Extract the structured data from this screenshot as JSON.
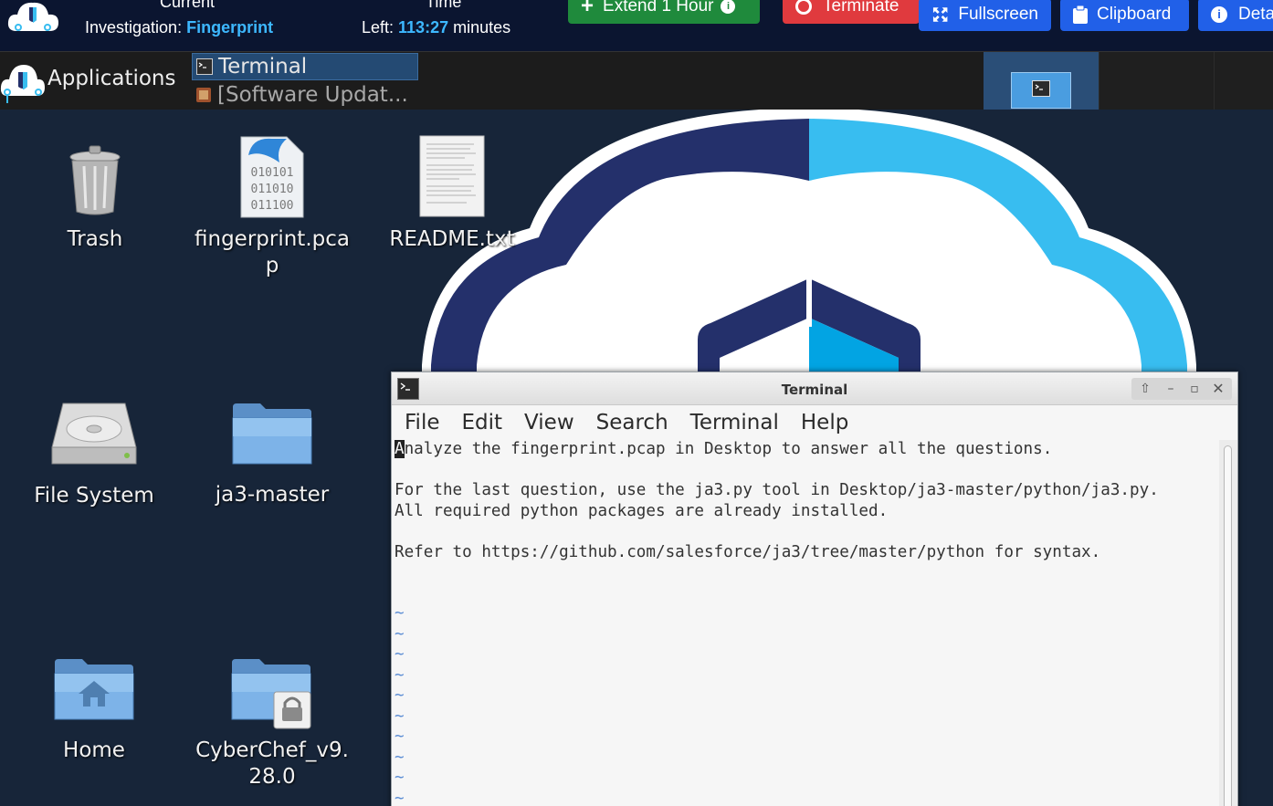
{
  "topbar": {
    "current_label": "Current",
    "investigation_label": "Investigation: ",
    "investigation_name": "Fingerprint",
    "time_label": "Time",
    "left_label": "Left: ",
    "time_left": "113:27",
    "minutes_label": " minutes",
    "extend_label": "Extend 1 Hour",
    "terminate_label": "Terminate",
    "fullscreen_label": "Fullscreen",
    "clipboard_label": "Clipboard",
    "details_label": "Deta"
  },
  "panel": {
    "applications_label": "Applications",
    "tasks": [
      {
        "label": "Terminal"
      },
      {
        "label": "[Software Updat..."
      }
    ]
  },
  "desktop": {
    "icons": [
      {
        "label": "Trash"
      },
      {
        "label": "fingerprint.pcap"
      },
      {
        "label": "README.txt"
      },
      {
        "label": "File System"
      },
      {
        "label": "ja3-master"
      },
      {
        "label": "Home"
      },
      {
        "label": "CyberChef_v9.28.0"
      }
    ],
    "pcap_bits": [
      "010101",
      "011010",
      "011100"
    ]
  },
  "terminal": {
    "title": "Terminal",
    "menu": [
      "File",
      "Edit",
      "View",
      "Search",
      "Terminal",
      "Help"
    ],
    "cursor_char": "A",
    "lines": [
      "nalyze the fingerprint.pcap in Desktop to answer all the questions.",
      "For the last question, use the ja3.py tool in Desktop/ja3-master/python/ja3.py.",
      "All required python packages are already installed.",
      "Refer to https://github.com/salesforce/ja3/tree/master/python for syntax."
    ],
    "tilde": "~"
  },
  "colors": {
    "topbar_bg": "#0b1530",
    "accent": "#3db8ff",
    "extend_green": "#1f8a3c",
    "terminate_red": "#e03a3e",
    "button_blue": "#2160e8",
    "desktop_bg": "#172539",
    "cloud_dark": "#24306b",
    "cloud_light": "#38bdf0"
  }
}
